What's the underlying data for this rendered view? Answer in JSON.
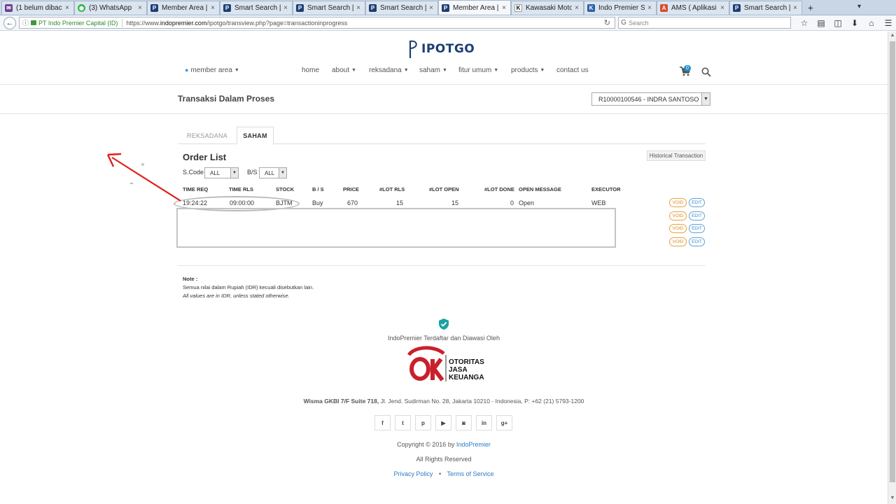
{
  "browser": {
    "tabs": [
      {
        "title": "(1 belum dibaca)...",
        "icon": "mail-icon",
        "active": false
      },
      {
        "title": "(3) WhatsApp",
        "icon": "whatsapp-icon",
        "active": false
      },
      {
        "title": "Member Area | I...",
        "icon": "ipot-icon",
        "active": false
      },
      {
        "title": "Smart Search | IP...",
        "icon": "ipot-icon",
        "active": false
      },
      {
        "title": "Smart Search | IP...",
        "icon": "ipot-icon",
        "active": false
      },
      {
        "title": "Smart Search | IP...",
        "icon": "ipot-icon",
        "active": false
      },
      {
        "title": "Member Area | I...",
        "icon": "ipot-icon",
        "active": true
      },
      {
        "title": "Kawasaki Motor ...",
        "icon": "k-icon",
        "active": false
      },
      {
        "title": "Indo Premier Sec...",
        "icon": "k-icon",
        "active": false
      },
      {
        "title": "AMS ( Aplikasi ...",
        "icon": "ams-icon",
        "active": false
      },
      {
        "title": "Smart Search | IP...",
        "icon": "ipot-icon",
        "active": false
      }
    ],
    "tab_close_glyph": "×",
    "new_tab_glyph": "+",
    "url_org": "PT Indo Premier Capital (ID)",
    "url_prefix": "https://www.",
    "url_domain": "indopremier.com",
    "url_path": "/ipotgo/transview.php?page=transactioninprogress",
    "search_placeholder": "Search"
  },
  "site": {
    "logo_text": "IPOTGO",
    "member_area": "member area",
    "menu": {
      "home": "home",
      "about": "about",
      "reksadana": "reksadana",
      "saham": "saham",
      "fitur_umum": "fitur umum",
      "products": "products",
      "contact_us": "contact us"
    },
    "cart_count": "0"
  },
  "page": {
    "title": "Transaksi Dalam Proses",
    "account": "R10000100546 - INDRA SANTOSO",
    "tabs": {
      "reksadana": "REKSADANA",
      "saham": "SAHAM"
    },
    "order_list_title": "Order List",
    "historical_button": "Historical Transaction",
    "filters": {
      "scode_label": "S.Code",
      "scode_value": "ALL",
      "bs_label": "B/S",
      "bs_value": "ALL"
    },
    "table": {
      "headers": [
        "TIME REQ",
        "TIME RLS",
        "STOCK",
        "B / S",
        "PRICE",
        "#LOT RLS",
        "#LOT OPEN",
        "#LOT DONE",
        "OPEN MESSAGE",
        "EXECUTOR"
      ],
      "rows": [
        {
          "time_req": "19:24:22",
          "time_rls": "09:00:00",
          "stock": "BJTM",
          "bs": "Buy",
          "price": "670",
          "lot_rls": "15",
          "lot_open": "15",
          "lot_done": "0",
          "open_message": "Open",
          "executor": "WEB"
        }
      ],
      "void_label": "VOID",
      "edit_label": "EDIT"
    },
    "note": {
      "title": "Note :",
      "line1": "Semua nilai dalam Rupiah (IDR) kecuali disebutkan lain.",
      "line2": "All values are in IDR, unless stated otherwise."
    }
  },
  "footer": {
    "registered": "IndoPremier Terdaftar dan Diawasi Oleh",
    "ojk_line1": "OTORITAS",
    "ojk_line2": "JASA",
    "ojk_line3": "KEUANGAN",
    "address_bold": "Wisma GKBI 7/F Suite 718,",
    "address_rest": " Jl. Jend. Sudirman No. 28, Jakarta 10210 - Indonesia, P: +62 (21) 5793-1200",
    "socials": [
      "f",
      "t",
      "p",
      "▶",
      "◙",
      "in",
      "g+"
    ],
    "copyright_prefix": "Copyright © 2016 by ",
    "copyright_link": "IndoPremier",
    "rights": "All Rights Reserved",
    "privacy": "Privacy Policy",
    "separator": "•",
    "terms": "Terms of Service"
  },
  "colors": {
    "brand": "#1d3f73",
    "link": "#2a7bc4",
    "annotation_arrow": "#e0201c",
    "void": "#e8a33a",
    "edit": "#5da3d9"
  }
}
